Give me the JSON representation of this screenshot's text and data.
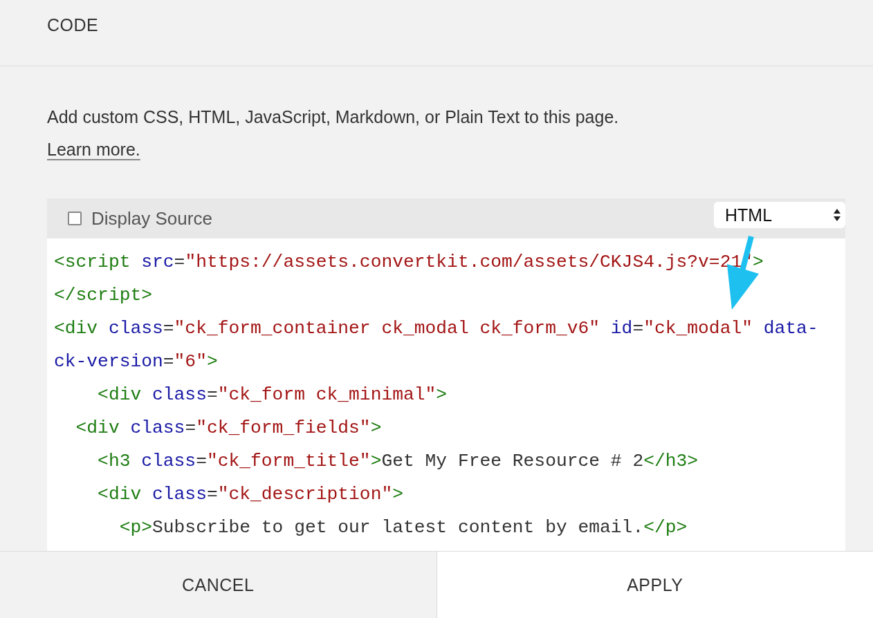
{
  "header": {
    "title": "CODE"
  },
  "description": "Add custom CSS, HTML, JavaScript, Markdown, or Plain Text to this page.",
  "learn_more_link": "Learn more.",
  "editor": {
    "display_source": {
      "label": "Display Source",
      "checked": false
    },
    "language_select": {
      "value": "HTML"
    },
    "lines": [
      [
        {
          "kind": "tag",
          "text": "<script "
        },
        {
          "kind": "attr",
          "text": "src"
        },
        {
          "kind": "punct",
          "text": "="
        },
        {
          "kind": "value",
          "text": "\"https://assets.convertkit.com/assets/CKJS4.js?v=21\""
        },
        {
          "kind": "tag",
          "text": ">"
        }
      ],
      [
        {
          "kind": "tag",
          "text": "</script>"
        }
      ],
      [
        {
          "kind": "tag",
          "text": "<div "
        },
        {
          "kind": "attr",
          "text": "class"
        },
        {
          "kind": "punct",
          "text": "="
        },
        {
          "kind": "value",
          "text": "\"ck_form_container ck_modal ck_form_v6\" "
        },
        {
          "kind": "attr",
          "text": "id"
        },
        {
          "kind": "punct",
          "text": "="
        },
        {
          "kind": "value",
          "text": "\"ck_modal\" "
        },
        {
          "kind": "attr",
          "text": "data-"
        }
      ],
      [
        {
          "kind": "attr",
          "text": "ck-version"
        },
        {
          "kind": "punct",
          "text": "="
        },
        {
          "kind": "value",
          "text": "\"6\""
        },
        {
          "kind": "tag",
          "text": ">"
        }
      ],
      [
        {
          "kind": "tag",
          "text": "    <div "
        },
        {
          "kind": "attr",
          "text": "class"
        },
        {
          "kind": "punct",
          "text": "="
        },
        {
          "kind": "value",
          "text": "\"ck_form ck_minimal\""
        },
        {
          "kind": "tag",
          "text": ">"
        }
      ],
      [
        {
          "kind": "tag",
          "text": "  <div "
        },
        {
          "kind": "attr",
          "text": "class"
        },
        {
          "kind": "punct",
          "text": "="
        },
        {
          "kind": "value",
          "text": "\"ck_form_fields\""
        },
        {
          "kind": "tag",
          "text": ">"
        }
      ],
      [
        {
          "kind": "tag",
          "text": "    <h3 "
        },
        {
          "kind": "attr",
          "text": "class"
        },
        {
          "kind": "punct",
          "text": "="
        },
        {
          "kind": "value",
          "text": "\"ck_form_title\""
        },
        {
          "kind": "tag",
          "text": ">"
        },
        {
          "kind": "text",
          "text": "Get My Free Resource # 2"
        },
        {
          "kind": "tag",
          "text": "</h3>"
        }
      ],
      [
        {
          "kind": "tag",
          "text": "    <div "
        },
        {
          "kind": "attr",
          "text": "class"
        },
        {
          "kind": "punct",
          "text": "="
        },
        {
          "kind": "value",
          "text": "\"ck_description\""
        },
        {
          "kind": "tag",
          "text": ">"
        }
      ],
      [
        {
          "kind": "tag",
          "text": "      <p>"
        },
        {
          "kind": "text",
          "text": "Subscribe to get our latest content by email."
        },
        {
          "kind": "tag",
          "text": "</p>"
        }
      ]
    ]
  },
  "footer": {
    "cancel": "CANCEL",
    "apply": "APPLY"
  }
}
